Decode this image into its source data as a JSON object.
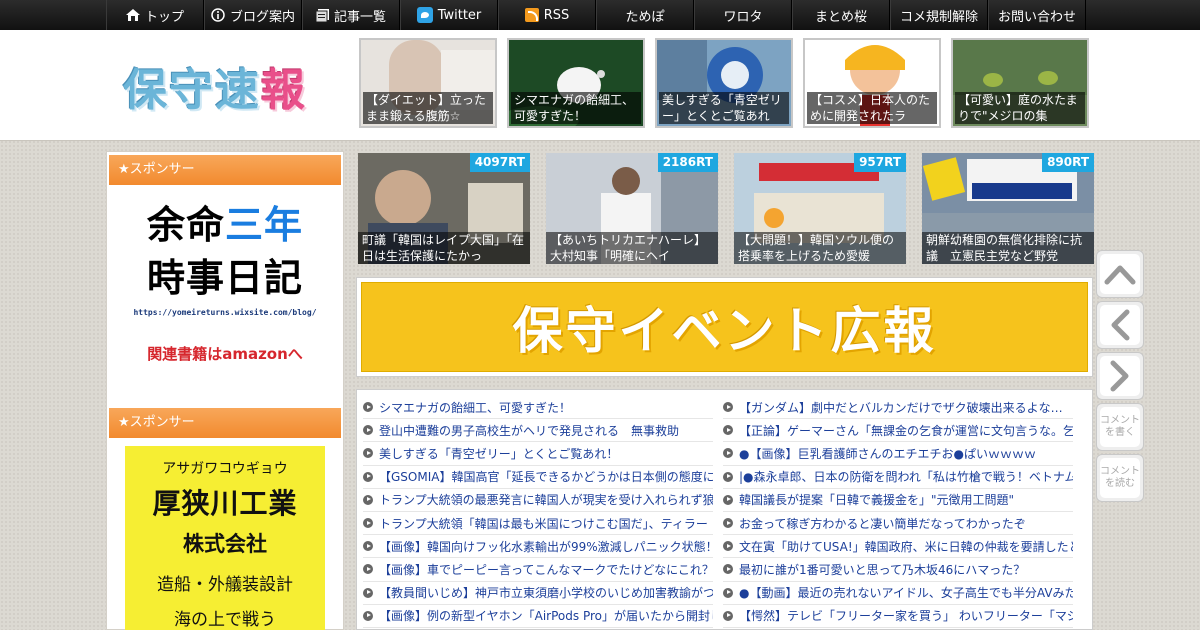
{
  "nav": [
    {
      "icon": "home-icon",
      "label": "トップ"
    },
    {
      "icon": "info-icon",
      "label": "ブログ案内"
    },
    {
      "icon": "list-icon",
      "label": "記事一覧"
    },
    {
      "icon": "twitter-icon",
      "label": "Twitter"
    },
    {
      "icon": "rss-icon",
      "label": "RSS"
    },
    {
      "icon": "",
      "label": "ためぽ"
    },
    {
      "icon": "",
      "label": "ワロタ"
    },
    {
      "icon": "",
      "label": "まとめ桜"
    },
    {
      "icon": "",
      "label": "コメ規制解除"
    },
    {
      "icon": "",
      "label": "お問い合わせ"
    }
  ],
  "logo": {
    "part1": "保守速",
    "part2": "報"
  },
  "featured": [
    {
      "caption": "【ダイエット】立ったまま鍛える腹筋☆"
    },
    {
      "caption": "シマエナガの飴細工、可愛すぎた！"
    },
    {
      "caption": "美しすぎる「青空ゼリー」とくとご覧あれ"
    },
    {
      "caption": "【コスメ】日本人のために開発されたラ"
    },
    {
      "caption": "【可愛い】庭の水たまりで\"メジロの集"
    }
  ],
  "sidebar": {
    "sponsor_label": "★スポンサー",
    "ad1": {
      "line1a": "余命",
      "line1b": "三年",
      "line2": "時事日記",
      "url": "https://yomeireturns.wixsite.com/blog/",
      "amazon": "関連書籍はamazonへ"
    },
    "ad2": {
      "kana": "アサガワコウギョウ",
      "name": "厚狭川工業",
      "corp": "株式会社",
      "desc": "造船・外艤装設計",
      "tail": "海の上で戦う"
    }
  },
  "retweets": [
    {
      "count": "4097RT",
      "caption": "町議「韓国はレイプ大国」「在日は生活保護にたかっ"
    },
    {
      "count": "2186RT",
      "caption": "【あいちトリカエナハーレ】大村知事「明確にヘイ"
    },
    {
      "count": "957RT",
      "caption": "【大問題！】韓国ソウル便の搭乗率を上げるため愛媛"
    },
    {
      "count": "890RT",
      "caption": "朝鮮幼稚園の無償化排除に抗議　立憲民主党など野党"
    }
  ],
  "banner": {
    "text": "保守イベント広報"
  },
  "news_left": [
    "シマエナガの飴細工、可愛すぎた！",
    "登山中遭難の男子高校生がヘリで発見される　無事救助",
    "美しすぎる「青空ゼリー」とくとご覧あれ！",
    "【GSOMIA】韓国高官「延長できるかどうかは日本側の態度に",
    "トランプ大統領の最悪発言に韓国人が現実を受け入れられず狼",
    "トランプ大統領「韓国は最も米国につけこむ国だ」、ティラー",
    "【画像】韓国向けフッ化水素輸出が99%激減しパニック状態！",
    "【画像】車でピーピー言ってこんなマークでたけどなにこれ？",
    "【教員間いじめ】神戸市立東須磨小学校のいじめ加害教諭がつ",
    "【画像】例の新型イヤホン「AirPods Pro」が届いたから開封し"
  ],
  "news_right": [
    "【ガンダム】劇中だとバルカンだけでザク破壊出来るよな…",
    "【正論】ゲーマーさん「無課金の乞食が運営に文句言うな。乞",
    "●【画像】巨乳看護師さんのエチエチお●ぱいｗｗｗｗ",
    "|●森永卓郎、日本の防衛を問われ「私は竹槍で戦う！ベトナム",
    "韓国議長が提案「日韓で義援金を」\"元徴用工問題\"",
    "お金って稼ぎ方わかると凄い簡単だなってわかったぞ",
    "文在寅「助けてUSA!」韓国政府、米に日韓の仲裁を要請したと",
    "最初に誰が1番可愛いと思って乃木坂46にハマった？",
    "●【動画】最近の売れないアイドル、女子高生でも半分AVみた",
    "【愕然】テレビ「フリーター家を買う」 わいフリーター「マジ"
  ],
  "floaters": [
    {
      "icon": "chevron-up-icon",
      "label": ""
    },
    {
      "icon": "chevron-left-icon",
      "label": ""
    },
    {
      "icon": "chevron-right-icon",
      "label": ""
    },
    {
      "icon": "",
      "label": "コメントを書く"
    },
    {
      "icon": "",
      "label": "コメントを読む"
    }
  ]
}
